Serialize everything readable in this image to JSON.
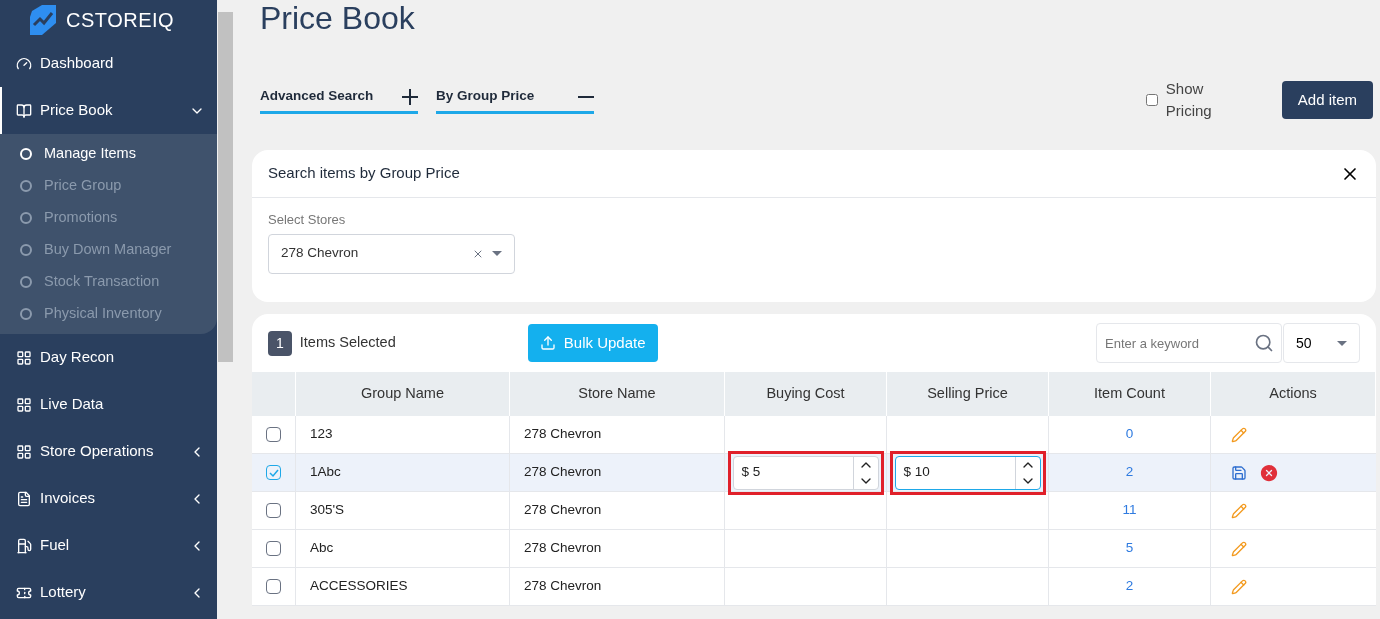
{
  "brand": {
    "name": "CSTOREIQ"
  },
  "sidebar": {
    "items": [
      {
        "label": "Dashboard",
        "has_submenu": false,
        "selected": false
      },
      {
        "label": "Price Book",
        "has_submenu": true,
        "expanded": true,
        "selected": true,
        "children": [
          {
            "label": "Manage Items",
            "selected": true
          },
          {
            "label": "Price Group",
            "selected": false
          },
          {
            "label": "Promotions",
            "selected": false
          },
          {
            "label": "Buy Down Manager",
            "selected": false
          },
          {
            "label": "Stock Transaction",
            "selected": false
          },
          {
            "label": "Physical Inventory",
            "selected": false
          }
        ]
      },
      {
        "label": "Day Recon",
        "has_submenu": false,
        "selected": false
      },
      {
        "label": "Live Data",
        "has_submenu": false,
        "selected": false
      },
      {
        "label": "Store Operations",
        "has_submenu": true,
        "expanded": false,
        "selected": false
      },
      {
        "label": "Invoices",
        "has_submenu": true,
        "expanded": false,
        "selected": false
      },
      {
        "label": "Fuel",
        "has_submenu": true,
        "expanded": false,
        "selected": false
      },
      {
        "label": "Lottery",
        "has_submenu": true,
        "expanded": false,
        "selected": false
      }
    ]
  },
  "page": {
    "title": "Price Book"
  },
  "search_tabs": [
    {
      "label": "Advanced Search",
      "expanded": false
    },
    {
      "label": "By Group Price",
      "expanded": true
    }
  ],
  "show_pricing": {
    "label": "Show Pricing",
    "checked": false
  },
  "add_button": "Add item",
  "search_panel": {
    "title": "Search items by Group Price",
    "field_label": "Select Stores",
    "value": "278 Chevron"
  },
  "toolbar": {
    "selected_count": "1",
    "selected_label": "Items Selected",
    "bulk_button": "Bulk Update",
    "search_placeholder": "Enter a keyword",
    "page_size": "50"
  },
  "table": {
    "columns": [
      "Group Name",
      "Store Name",
      "Buying Cost",
      "Selling Price",
      "Item Count",
      "Actions"
    ],
    "rows": [
      {
        "group": "123",
        "store": "278 Chevron",
        "count": "0",
        "checked": false,
        "editing": false
      },
      {
        "group": "1Abc",
        "store": "278 Chevron",
        "count": "2",
        "checked": true,
        "editing": true,
        "currency": "$",
        "buying_cost": "5",
        "selling_price": "10",
        "outlined": true
      },
      {
        "group": "305'S",
        "store": "278 Chevron",
        "count": "11",
        "checked": false,
        "editing": false
      },
      {
        "group": "Abc",
        "store": "278 Chevron",
        "count": "5",
        "checked": false,
        "editing": false
      },
      {
        "group": "ACCESSORIES",
        "store": "278 Chevron",
        "count": "2",
        "checked": false,
        "editing": false
      }
    ]
  }
}
